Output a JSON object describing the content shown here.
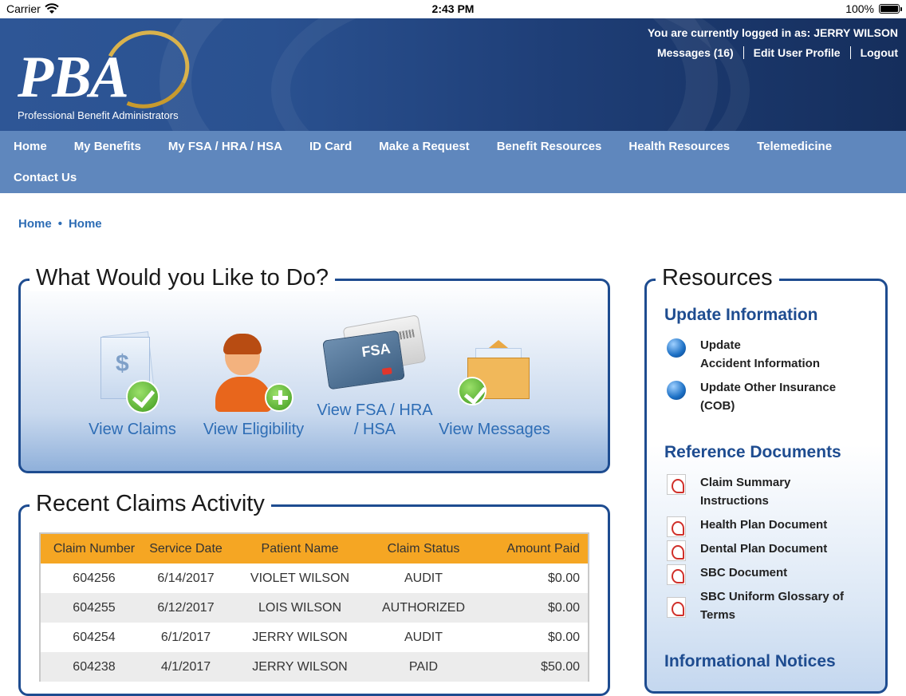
{
  "statusbar": {
    "carrier": "Carrier",
    "time": "2:43 PM",
    "battery": "100%"
  },
  "header": {
    "logo_text": "PBA",
    "logo_tagline": "Professional Benefit Administrators",
    "logged_in": "You are currently logged in as: JERRY WILSON",
    "links": [
      "Messages (16)",
      "Edit User Profile",
      "Logout"
    ]
  },
  "nav": {
    "row1": [
      "Home",
      "My Benefits",
      "My FSA / HRA / HSA",
      "ID Card",
      "Make a Request",
      "Benefit Resources",
      "Health Resources",
      "Telemedicine"
    ],
    "row2": [
      "Contact Us"
    ]
  },
  "breadcrumb": [
    "Home",
    "•",
    "Home"
  ],
  "todo": {
    "title": "What Would you Like to Do?",
    "actions": {
      "claims": "View Claims",
      "eligibility": "View Eligibility",
      "fsa_line1": "View FSA / HRA",
      "fsa_line2": "/ HSA",
      "fsa_card": "FSA",
      "messages": "View Messages"
    }
  },
  "claims": {
    "title": "Recent Claims Activity",
    "columns": [
      "Claim Number",
      "Service Date",
      "Patient Name",
      "Claim Status",
      "Amount Paid"
    ],
    "rows": [
      [
        "604256",
        "6/14/2017",
        "VIOLET WILSON",
        "AUDIT",
        "$0.00"
      ],
      [
        "604255",
        "6/12/2017",
        "LOIS WILSON",
        "AUTHORIZED",
        "$0.00"
      ],
      [
        "604254",
        "6/1/2017",
        "JERRY WILSON",
        "AUDIT",
        "$0.00"
      ],
      [
        "604238",
        "4/1/2017",
        "JERRY WILSON",
        "PAID",
        "$50.00"
      ]
    ]
  },
  "resources": {
    "title": "Resources",
    "update_heading": "Update Information",
    "update_items": [
      [
        "Update",
        "Accident Information"
      ],
      [
        "Update Other Insurance",
        "(COB)"
      ]
    ],
    "ref_heading": "Reference Documents",
    "ref_items": [
      [
        "Claim Summary",
        "Instructions"
      ],
      [
        "Health Plan Document"
      ],
      [
        "Dental Plan Document"
      ],
      [
        "SBC Document"
      ],
      [
        "SBC Uniform Glossary of",
        "Terms"
      ]
    ],
    "notices_heading": "Informational Notices"
  }
}
